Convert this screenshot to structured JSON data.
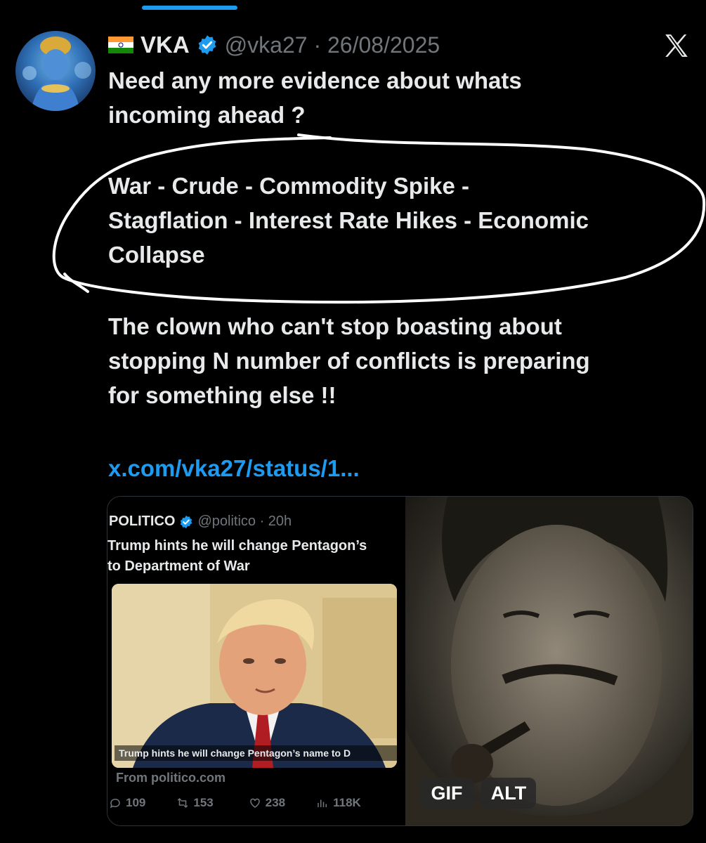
{
  "tweet": {
    "display_name": "VKA",
    "handle_date": "@vka27 · 26/08/2025",
    "text_lines_1": [
      "Need any more evidence about whats",
      "incoming ahead ?"
    ],
    "text_lines_2": [
      "War - Crude - Commodity Spike -",
      "Stagflation - Interest Rate Hikes - Economic",
      "Collapse"
    ],
    "text_lines_3": [
      "The clown who can't stop boasting about",
      "stopping N number of conflicts is preparing",
      "for something else !!"
    ],
    "link": "x.com/vka27/status/1..."
  },
  "quoted": {
    "name": "POLITICO",
    "handle_time": "@politico · 20h",
    "text_lines": [
      "Trump hints he will change Pentagon’s",
      "to Department of War"
    ],
    "image_caption": "Trump hints he will change Pentagon’s name to D",
    "from": "From politico.com",
    "stats": {
      "replies": "109",
      "reposts": "153",
      "likes": "238",
      "views": "118K"
    }
  },
  "media_badges": {
    "gif": "GIF",
    "alt": "ALT"
  },
  "colors": {
    "accent": "#1d9bf0",
    "muted": "#71767b",
    "text": "#e7e9ea",
    "background": "#000000"
  },
  "icons": [
    "india-flag-icon",
    "verified-badge-icon",
    "x-logo-icon",
    "reply-icon",
    "repost-icon",
    "like-icon",
    "views-icon"
  ]
}
